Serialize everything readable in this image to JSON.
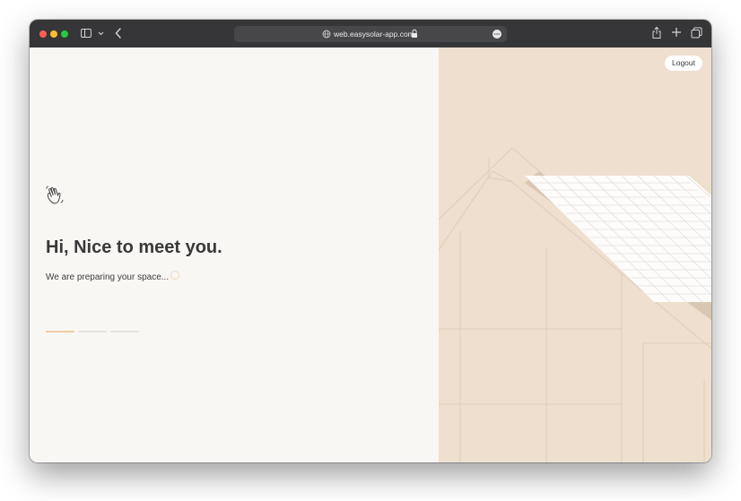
{
  "browser": {
    "url": "web.easysolar-app.com",
    "icons": [
      "sidebar-icon",
      "chevron-down-icon",
      "back-icon",
      "globe-icon",
      "lock-icon",
      "more-icon",
      "share-icon",
      "new-tab-icon",
      "tabs-overview-icon"
    ]
  },
  "header": {
    "logout_label": "Logout"
  },
  "welcome": {
    "icon": "waving-hand-icon",
    "title": "Hi, Nice to meet you.",
    "subtitle": "We are preparing your space...",
    "loading_icon": "spinner-icon"
  },
  "progress": {
    "steps_total": 3,
    "steps_active": 1
  },
  "colors": {
    "left_background": "#f9f7f4",
    "right_background": "#eedfcf",
    "accent": "#efc9a3",
    "text": "#3a3838"
  }
}
